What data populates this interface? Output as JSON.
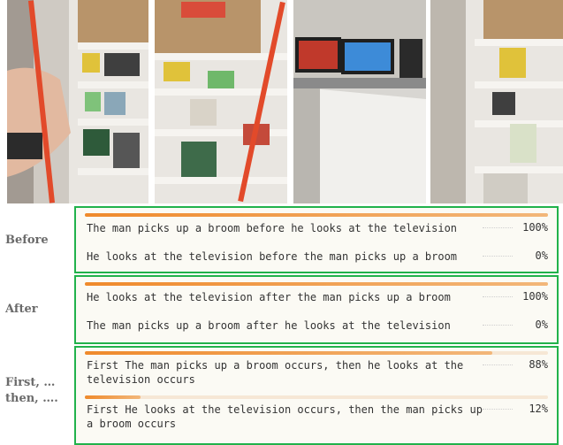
{
  "rows": [
    {
      "label": "Before",
      "options": [
        {
          "text": "The man picks up a broom before he looks at the television",
          "percent": "100%",
          "fraction": 1.0
        },
        {
          "text": "He looks at the television before the man picks up a broom",
          "percent": "0%",
          "fraction": 0.0
        }
      ]
    },
    {
      "label": "After",
      "options": [
        {
          "text": "He looks at the television after the man picks up a broom",
          "percent": "100%",
          "fraction": 1.0
        },
        {
          "text": "The man picks up a broom after he looks at the television",
          "percent": "0%",
          "fraction": 0.0
        }
      ]
    },
    {
      "label": "First, …\nthen, ….",
      "label_line1": "First, …",
      "label_line2": "then, ….",
      "options": [
        {
          "text": "First The man picks up a broom occurs, then he looks at the television occurs",
          "percent": "88%",
          "fraction": 0.88
        },
        {
          "text": "First He looks at the television occurs, then the man picks up a broom occurs",
          "percent": "12%",
          "fraction": 0.12
        }
      ]
    }
  ],
  "colors": {
    "accent_bar": "#ef8a2c",
    "panel_border": "#21b24b"
  }
}
